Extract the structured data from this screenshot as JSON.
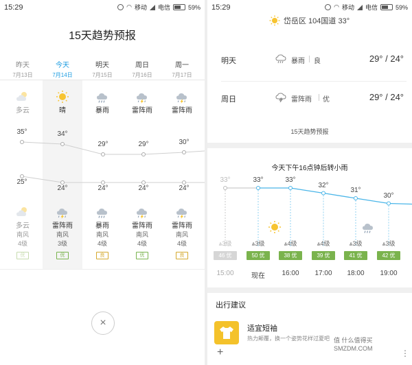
{
  "left": {
    "status": {
      "time": "15:29",
      "carrier1": "移动",
      "carrier2": "电信",
      "battery": "59%"
    },
    "title": "15天趋势预报",
    "days": [
      {
        "name": "昨天",
        "date": "7月13日",
        "day_cond": "多云",
        "high": "35°",
        "low": "25°",
        "night_cond": "多云",
        "wind_dir": "南风",
        "wind_level": "4级",
        "aqi": "优",
        "day_icon": "partly-cloudy-icon",
        "night_icon": "partly-cloudy-icon",
        "faded": true
      },
      {
        "name": "今天",
        "date": "7月14日",
        "day_cond": "晴",
        "high": "34°",
        "low": "24°",
        "night_cond": "雷阵雨",
        "wind_dir": "南风",
        "wind_level": "3级",
        "aqi": "优",
        "day_icon": "sun-icon",
        "night_icon": "thunderstorm-icon",
        "selected": true
      },
      {
        "name": "明天",
        "date": "7月15日",
        "day_cond": "暴雨",
        "high": "29°",
        "low": "24°",
        "night_cond": "暴雨",
        "wind_dir": "南风",
        "wind_level": "4级",
        "aqi": "良",
        "day_icon": "heavy-rain-icon",
        "night_icon": "heavy-rain-icon"
      },
      {
        "name": "周日",
        "date": "7月16日",
        "day_cond": "雷阵雨",
        "high": "29°",
        "low": "24°",
        "night_cond": "雷阵雨",
        "wind_dir": "南风",
        "wind_level": "4级",
        "aqi": "优",
        "day_icon": "thunderstorm-icon",
        "night_icon": "thunderstorm-icon"
      },
      {
        "name": "周一",
        "date": "7月17日",
        "day_cond": "雷阵雨",
        "high": "30°",
        "low": "24°",
        "night_cond": "雷阵雨",
        "wind_dir": "南风",
        "wind_level": "4级",
        "aqi": "良",
        "day_icon": "thunderstorm-icon",
        "night_icon": "thunderstorm-icon"
      }
    ],
    "close_glyph": "×"
  },
  "right": {
    "status": {
      "time": "15:29",
      "carrier1": "移动",
      "carrier2": "电信",
      "battery": "59%"
    },
    "location": "岱岳区 104国道 33°",
    "forecast_rows": [
      {
        "day": "明天",
        "cond": "暴雨",
        "aqi": "良",
        "temp": "29° / 24°",
        "icon": "heavy-rain-icon"
      },
      {
        "day": "周日",
        "cond": "雷阵雨",
        "aqi": "优",
        "temp": "29° / 24°",
        "icon": "thunderstorm-icon"
      }
    ],
    "trend_link": "15天趋势预报",
    "hourly_title": "今天下午16点钟后转小雨",
    "hours": [
      {
        "time": "15:00",
        "temp": "33°",
        "wind": "3级",
        "aqi": "46 优",
        "faded": true
      },
      {
        "time": "现在",
        "temp": "33°",
        "wind": "3级",
        "aqi": "50 优"
      },
      {
        "time": "16:00",
        "temp": "33°",
        "wind": "4级",
        "aqi": "38 优"
      },
      {
        "time": "17:00",
        "temp": "32°",
        "wind": "4级",
        "aqi": "39 优"
      },
      {
        "time": "18:00",
        "temp": "31°",
        "wind": "3级",
        "aqi": "41 优"
      },
      {
        "time": "19:00",
        "temp": "30°",
        "wind": "3级",
        "aqi": "42 优"
      }
    ],
    "advice_title": "出行建议",
    "advice_item": {
      "title": "适宜短袖",
      "desc": "热力颠覆，换一个姿势花样过夏吧"
    },
    "plus": "+",
    "watermark": "值 什么值得买 SMZDM.COM"
  },
  "colors": {
    "accent": "#1a9be0",
    "aqi_good": "#7ab34d",
    "aqi_ok": "#d4a92e",
    "line_blue": "#49b5e8",
    "advice_icon_bg": "#f4c22b"
  }
}
